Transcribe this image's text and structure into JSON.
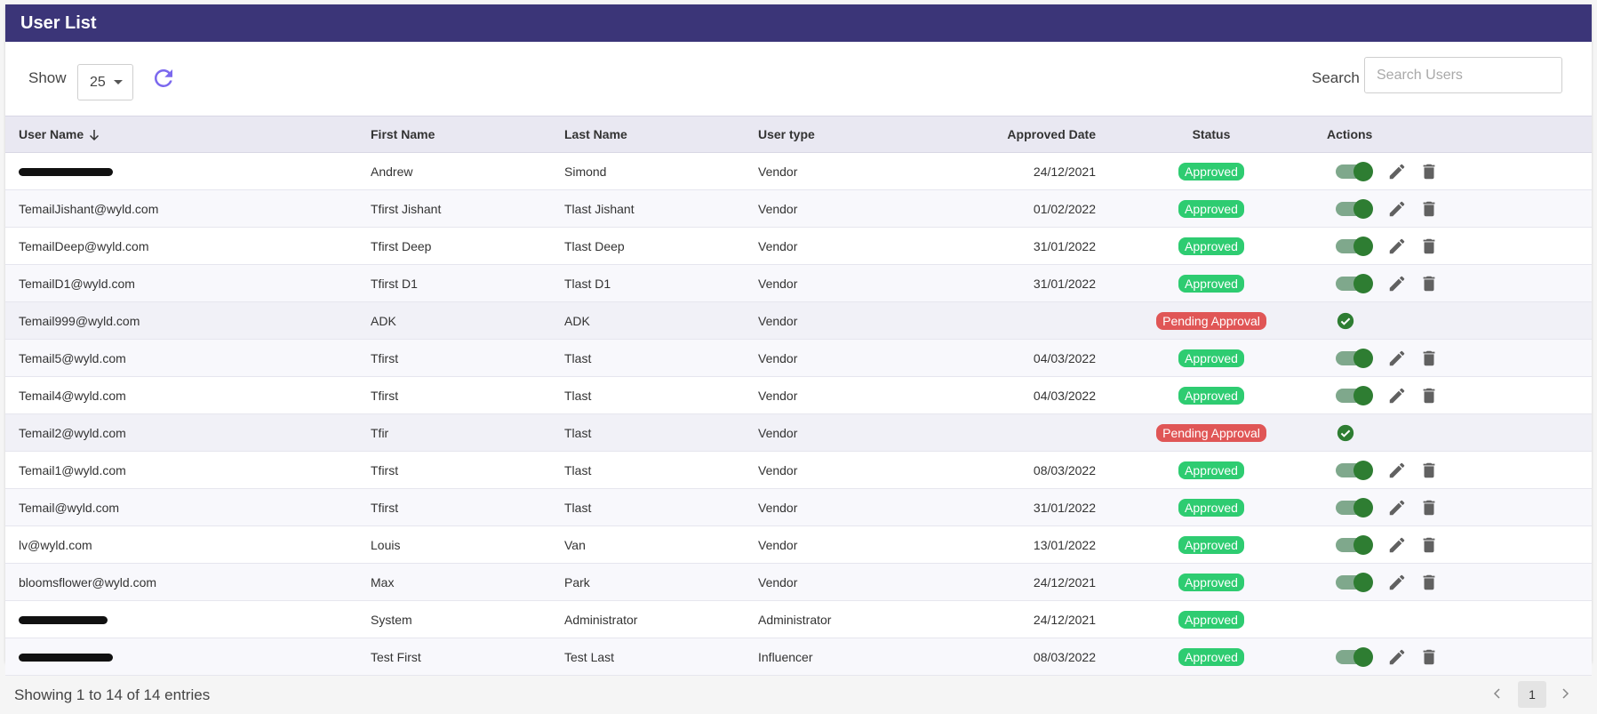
{
  "header": {
    "title": "User List"
  },
  "toolbar": {
    "show_label": "Show",
    "page_size": "25",
    "search_label": "Search",
    "search_placeholder": "Search Users",
    "search_value": ""
  },
  "colors": {
    "header_bg": "#3b3578",
    "approved": "#2ecc71",
    "pending": "#e05656",
    "toggle_on": "#2e7d32",
    "refresh_icon": "#7b68ee"
  },
  "table": {
    "columns": [
      "User Name",
      "First Name",
      "Last Name",
      "User type",
      "Approved Date",
      "Status",
      "Actions"
    ],
    "rows": [
      {
        "user": "",
        "redacted": true,
        "first": "Andrew",
        "last": "Simond",
        "type": "Vendor",
        "date": "24/12/2021",
        "status": "Approved",
        "actions": "full"
      },
      {
        "user": "TemailJishant@wyld.com",
        "first": "Tfirst Jishant",
        "last": "Tlast Jishant",
        "type": "Vendor",
        "date": "01/02/2022",
        "status": "Approved",
        "actions": "full"
      },
      {
        "user": "TemailDeep@wyld.com",
        "first": "Tfirst Deep",
        "last": "Tlast Deep",
        "type": "Vendor",
        "date": "31/01/2022",
        "status": "Approved",
        "actions": "full"
      },
      {
        "user": "TemailD1@wyld.com",
        "first": "Tfirst D1",
        "last": "Tlast D1",
        "type": "Vendor",
        "date": "31/01/2022",
        "status": "Approved",
        "actions": "full"
      },
      {
        "user": "Temail999@wyld.com",
        "first": "ADK",
        "last": "ADK",
        "type": "Vendor",
        "date": "",
        "status": "Pending Approval",
        "actions": "approve"
      },
      {
        "user": "Temail5@wyld.com",
        "first": "Tfirst",
        "last": "Tlast",
        "type": "Vendor",
        "date": "04/03/2022",
        "status": "Approved",
        "actions": "full"
      },
      {
        "user": "Temail4@wyld.com",
        "first": "Tfirst",
        "last": "Tlast",
        "type": "Vendor",
        "date": "04/03/2022",
        "status": "Approved",
        "actions": "full"
      },
      {
        "user": "Temail2@wyld.com",
        "first": "Tfir",
        "last": "Tlast",
        "type": "Vendor",
        "date": "",
        "status": "Pending Approval",
        "actions": "approve"
      },
      {
        "user": "Temail1@wyld.com",
        "first": "Tfirst",
        "last": "Tlast",
        "type": "Vendor",
        "date": "08/03/2022",
        "status": "Approved",
        "actions": "full"
      },
      {
        "user": "Temail@wyld.com",
        "first": "Tfirst",
        "last": "Tlast",
        "type": "Vendor",
        "date": "31/01/2022",
        "status": "Approved",
        "actions": "full"
      },
      {
        "user": "lv@wyld.com",
        "first": "Louis",
        "last": "Van",
        "type": "Vendor",
        "date": "13/01/2022",
        "status": "Approved",
        "actions": "full"
      },
      {
        "user": "bloomsflower@wyld.com",
        "first": "Max",
        "last": "Park",
        "type": "Vendor",
        "date": "24/12/2021",
        "status": "Approved",
        "actions": "full"
      },
      {
        "user": "",
        "redacted": true,
        "first": "System",
        "last": "Administrator",
        "type": "Administrator",
        "date": "24/12/2021",
        "status": "Approved",
        "actions": "none"
      },
      {
        "user": "",
        "redacted": true,
        "first": "Test First",
        "last": "Test Last",
        "type": "Influencer",
        "date": "08/03/2022",
        "status": "Approved",
        "actions": "full"
      }
    ]
  },
  "footer": {
    "summary": "Showing 1 to 14 of 14 entries",
    "current_page": "1"
  }
}
